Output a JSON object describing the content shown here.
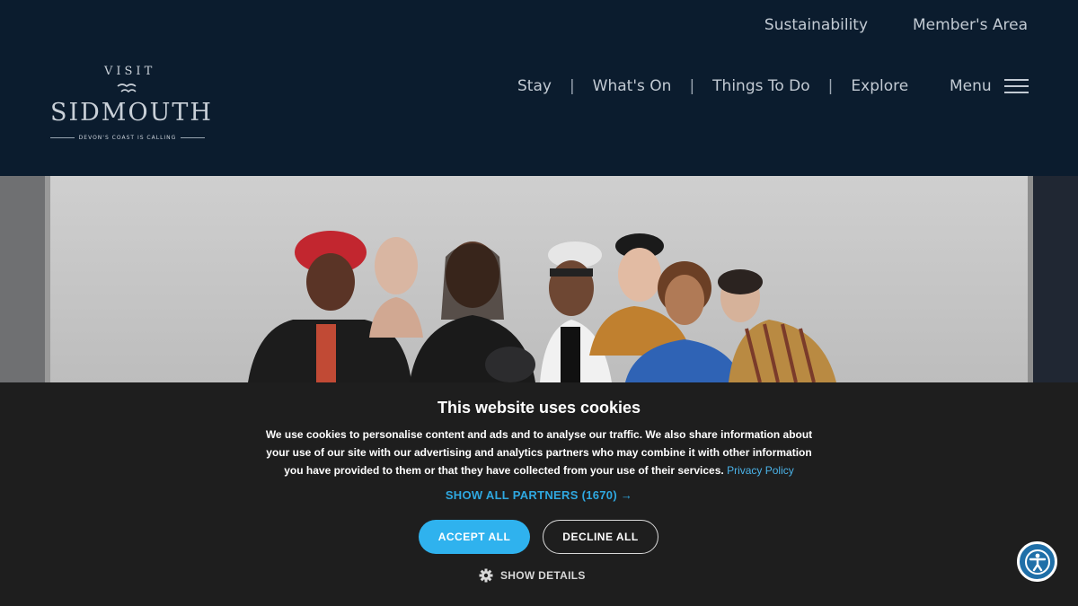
{
  "utility_nav": [
    "Sustainability",
    "Member's Area"
  ],
  "logo": {
    "visit": "VISIT",
    "name": "SIDMOUTH",
    "tagline": "DEVON'S COAST IS CALLING"
  },
  "main_nav": [
    "Stay",
    "What's On",
    "Things To Do",
    "Explore"
  ],
  "nav_separator": "|",
  "menu_label": "Menu",
  "cookie": {
    "title": "This website uses cookies",
    "body": "We use cookies to personalise content and ads and to analyse our traffic. We also share information about your use of our site with our advertising and analytics partners who may combine it with other information you have provided to them or that they have collected from your use of their services.",
    "privacy_link": "Privacy Policy",
    "partners_link": "SHOW ALL PARTNERS (1670) →",
    "accept_label": "ACCEPT ALL",
    "decline_label": "DECLINE ALL",
    "details_label": "SHOW DETAILS"
  },
  "colors": {
    "header_bg": "#0b1c2e",
    "banner_bg": "#1e1e1e",
    "accent": "#2fb2ee",
    "link": "#4bb3e8"
  },
  "icons": [
    "hamburger-icon",
    "gear-icon",
    "accessibility-icon"
  ]
}
